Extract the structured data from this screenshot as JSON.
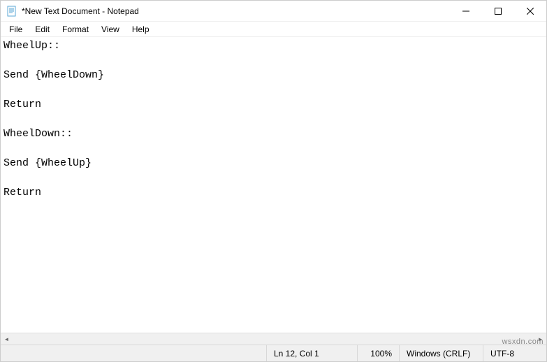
{
  "window": {
    "title": "*New Text Document - Notepad"
  },
  "menu": {
    "file": "File",
    "edit": "Edit",
    "format": "Format",
    "view": "View",
    "help": "Help"
  },
  "editor": {
    "content": "WheelUp::\n\nSend {WheelDown}\n\nReturn\n\nWheelDown::\n\nSend {WheelUp}\n\nReturn"
  },
  "status": {
    "position": "Ln 12, Col 1",
    "zoom": "100%",
    "eol": "Windows (CRLF)",
    "encoding": "UTF-8"
  },
  "watermark": "wsxdn.com"
}
